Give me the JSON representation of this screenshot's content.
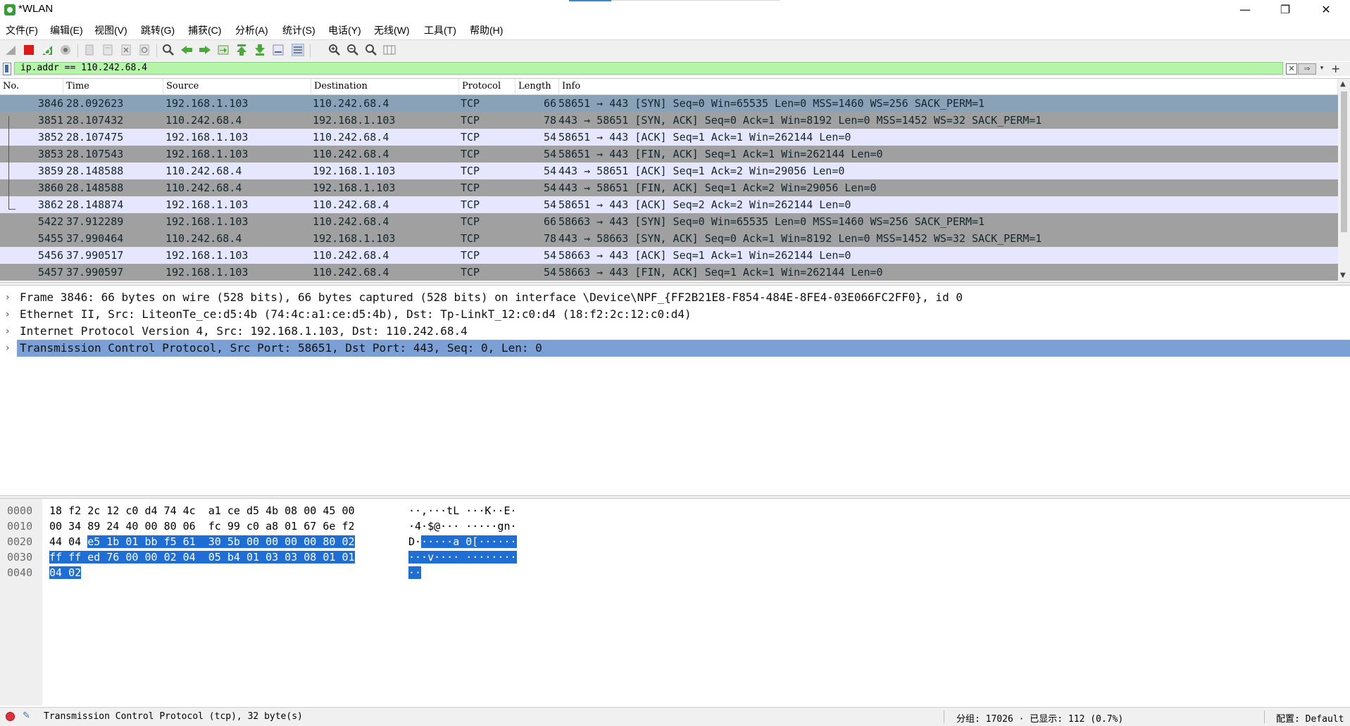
{
  "window": {
    "title": "*WLAN",
    "controls": {
      "minimize": "—",
      "maximize": "❐",
      "close": "✕"
    }
  },
  "menu": [
    "文件(F)",
    "编辑(E)",
    "视图(V)",
    "跳转(G)",
    "捕获(C)",
    "分析(A)",
    "统计(S)",
    "电话(Y)",
    "无线(W)",
    "工具(T)",
    "帮助(H)"
  ],
  "filter": {
    "value": "ip.addr == 110.242.68.4",
    "clear_icon": "✕",
    "apply_icon": "⇒",
    "dropdown_icon": "▾",
    "add_icon": "+"
  },
  "packet_list": {
    "columns": [
      "No.",
      "Time",
      "Source",
      "Destination",
      "Protocol",
      "Length",
      "Info"
    ],
    "rows": [
      {
        "no": "3846",
        "time": "28.092623",
        "src": "192.168.1.103",
        "dst": "110.242.68.4",
        "proto": "TCP",
        "len": "66",
        "info": "58651 → 443 [SYN] Seq=0 Win=65535 Len=0 MSS=1460 WS=256 SACK_PERM=1",
        "style": "sel"
      },
      {
        "no": "3851",
        "time": "28.107432",
        "src": "110.242.68.4",
        "dst": "192.168.1.103",
        "proto": "TCP",
        "len": "78",
        "info": "443 → 58651 [SYN, ACK] Seq=0 Ack=1 Win=8192 Len=0 MSS=1452 WS=32 SACK_PERM=1",
        "style": "syn"
      },
      {
        "no": "3852",
        "time": "28.107475",
        "src": "192.168.1.103",
        "dst": "110.242.68.4",
        "proto": "TCP",
        "len": "54",
        "info": "58651 → 443 [ACK] Seq=1 Ack=1 Win=262144 Len=0",
        "style": "tcp"
      },
      {
        "no": "3853",
        "time": "28.107543",
        "src": "192.168.1.103",
        "dst": "110.242.68.4",
        "proto": "TCP",
        "len": "54",
        "info": "58651 → 443 [FIN, ACK] Seq=1 Ack=1 Win=262144 Len=0",
        "style": "syn"
      },
      {
        "no": "3859",
        "time": "28.148588",
        "src": "110.242.68.4",
        "dst": "192.168.1.103",
        "proto": "TCP",
        "len": "54",
        "info": "443 → 58651 [ACK] Seq=1 Ack=2 Win=29056 Len=0",
        "style": "tcp"
      },
      {
        "no": "3860",
        "time": "28.148588",
        "src": "110.242.68.4",
        "dst": "192.168.1.103",
        "proto": "TCP",
        "len": "54",
        "info": "443 → 58651 [FIN, ACK] Seq=1 Ack=2 Win=29056 Len=0",
        "style": "syn"
      },
      {
        "no": "3862",
        "time": "28.148874",
        "src": "192.168.1.103",
        "dst": "110.242.68.4",
        "proto": "TCP",
        "len": "54",
        "info": "58651 → 443 [ACK] Seq=2 Ack=2 Win=262144 Len=0",
        "style": "tcp"
      },
      {
        "no": "5422",
        "time": "37.912289",
        "src": "192.168.1.103",
        "dst": "110.242.68.4",
        "proto": "TCP",
        "len": "66",
        "info": "58663 → 443 [SYN] Seq=0 Win=65535 Len=0 MSS=1460 WS=256 SACK_PERM=1",
        "style": "syn"
      },
      {
        "no": "5455",
        "time": "37.990464",
        "src": "110.242.68.4",
        "dst": "192.168.1.103",
        "proto": "TCP",
        "len": "78",
        "info": "443 → 58663 [SYN, ACK] Seq=0 Ack=1 Win=8192 Len=0 MSS=1452 WS=32 SACK_PERM=1",
        "style": "syn"
      },
      {
        "no": "5456",
        "time": "37.990517",
        "src": "192.168.1.103",
        "dst": "110.242.68.4",
        "proto": "TCP",
        "len": "54",
        "info": "58663 → 443 [ACK] Seq=1 Ack=1 Win=262144 Len=0",
        "style": "tcp"
      },
      {
        "no": "5457",
        "time": "37.990597",
        "src": "192.168.1.103",
        "dst": "110.242.68.4",
        "proto": "TCP",
        "len": "54",
        "info": "58663 → 443 [FIN, ACK] Seq=1 Ack=1 Win=262144 Len=0",
        "style": "syn"
      }
    ]
  },
  "details": [
    {
      "text": "Frame 3846: 66 bytes on wire (528 bits), 66 bytes captured (528 bits) on interface \\Device\\NPF_{FF2B21E8-F854-484E-8FE4-03E066FC2FF0}, id 0",
      "selected": false
    },
    {
      "text": "Ethernet II, Src: LiteonTe_ce:d5:4b (74:4c:a1:ce:d5:4b), Dst: Tp-LinkT_12:c0:d4 (18:f2:2c:12:c0:d4)",
      "selected": false
    },
    {
      "text": "Internet Protocol Version 4, Src: 192.168.1.103, Dst: 110.242.68.4",
      "selected": false
    },
    {
      "text": "Transmission Control Protocol, Src Port: 58651, Dst Port: 443, Seq: 0, Len: 0",
      "selected": true
    }
  ],
  "bytes": [
    {
      "offset": "0000",
      "hex": [
        "18",
        "f2",
        "2c",
        "12",
        "c0",
        "d4",
        "74",
        "4c",
        "a1",
        "ce",
        "d5",
        "4b",
        "08",
        "00",
        "45",
        "00"
      ],
      "ascii": "··,···tL ···K··E·",
      "hl_start": 16
    },
    {
      "offset": "0010",
      "hex": [
        "00",
        "34",
        "89",
        "24",
        "40",
        "00",
        "80",
        "06",
        "fc",
        "99",
        "c0",
        "a8",
        "01",
        "67",
        "6e",
        "f2"
      ],
      "ascii": "·4·$@··· ·····gn·",
      "hl_start": 16
    },
    {
      "offset": "0020",
      "hex": [
        "44",
        "04",
        "e5",
        "1b",
        "01",
        "bb",
        "f5",
        "61",
        "30",
        "5b",
        "00",
        "00",
        "00",
        "00",
        "80",
        "02"
      ],
      "ascii": "D······a 0[······",
      "hl_start": 2
    },
    {
      "offset": "0030",
      "hex": [
        "ff",
        "ff",
        "ed",
        "76",
        "00",
        "00",
        "02",
        "04",
        "05",
        "b4",
        "01",
        "03",
        "03",
        "08",
        "01",
        "01"
      ],
      "ascii": "···v···· ········",
      "hl_start": 0
    },
    {
      "offset": "0040",
      "hex": [
        "04",
        "02"
      ],
      "ascii": "··",
      "hl_start": 0
    }
  ],
  "status": {
    "left_text": "Transmission Control Protocol (tcp), 32 byte(s)",
    "packets_text": "分组: 17026 · 已显示: 112 (0.7%)",
    "profile_text": "配置: Default"
  }
}
